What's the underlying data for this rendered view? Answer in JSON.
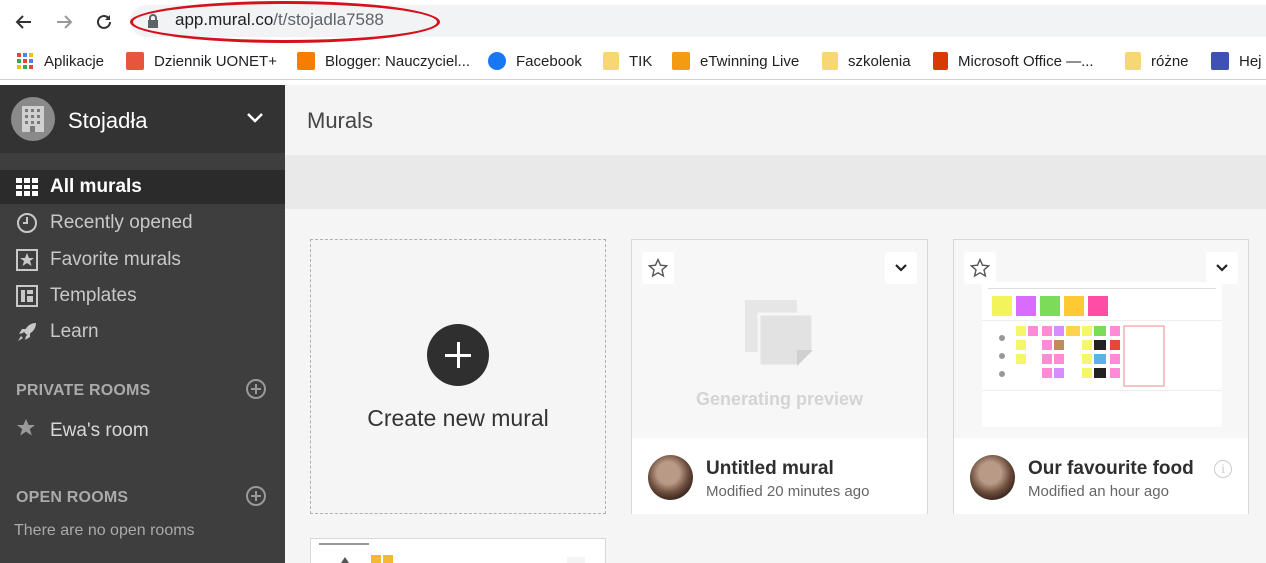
{
  "browser": {
    "url_host": "app.mural.co",
    "url_path": "/t/stojadla7588",
    "bookmarks": [
      {
        "label": "Aplikacje",
        "icon": "apps-grid-icon"
      },
      {
        "label": "Dziennik UONET+",
        "icon": "uonet-icon"
      },
      {
        "label": "Blogger: Nauczyciel...",
        "icon": "blogger-icon"
      },
      {
        "label": "Facebook",
        "icon": "facebook-icon"
      },
      {
        "label": "TIK",
        "icon": "folder-icon"
      },
      {
        "label": "eTwinning Live",
        "icon": "etwinning-icon"
      },
      {
        "label": "szkolenia",
        "icon": "folder-icon"
      },
      {
        "label": "Microsoft Office —...",
        "icon": "office-icon"
      },
      {
        "label": "różne",
        "icon": "folder-icon"
      },
      {
        "label": "Hej",
        "icon": "forms-icon"
      }
    ]
  },
  "sidebar": {
    "workspace_name": "Stojadła",
    "nav": [
      {
        "label": "All murals",
        "icon": "grid-icon",
        "active": true
      },
      {
        "label": "Recently opened",
        "icon": "clock-icon"
      },
      {
        "label": "Favorite murals",
        "icon": "star-box-icon"
      },
      {
        "label": "Templates",
        "icon": "templates-icon"
      },
      {
        "label": "Learn",
        "icon": "rocket-icon"
      }
    ],
    "private_rooms_title": "PRIVATE ROOMS",
    "private_rooms": [
      {
        "label": "Ewa's room",
        "icon": "star-icon"
      }
    ],
    "open_rooms_title": "OPEN ROOMS",
    "open_rooms_empty": "There are no open rooms"
  },
  "main": {
    "title": "Murals",
    "create_label": "Create new mural",
    "murals": [
      {
        "title": "Untitled mural",
        "modified": "Modified 20 minutes ago",
        "preview_text": "Generating preview"
      },
      {
        "title": "Our favourite food",
        "modified": "Modified an hour ago",
        "info_glyph": "i"
      }
    ]
  },
  "colors": {
    "sidebar_bg": "#3e3e3e",
    "url_highlight": "#d4111c"
  }
}
